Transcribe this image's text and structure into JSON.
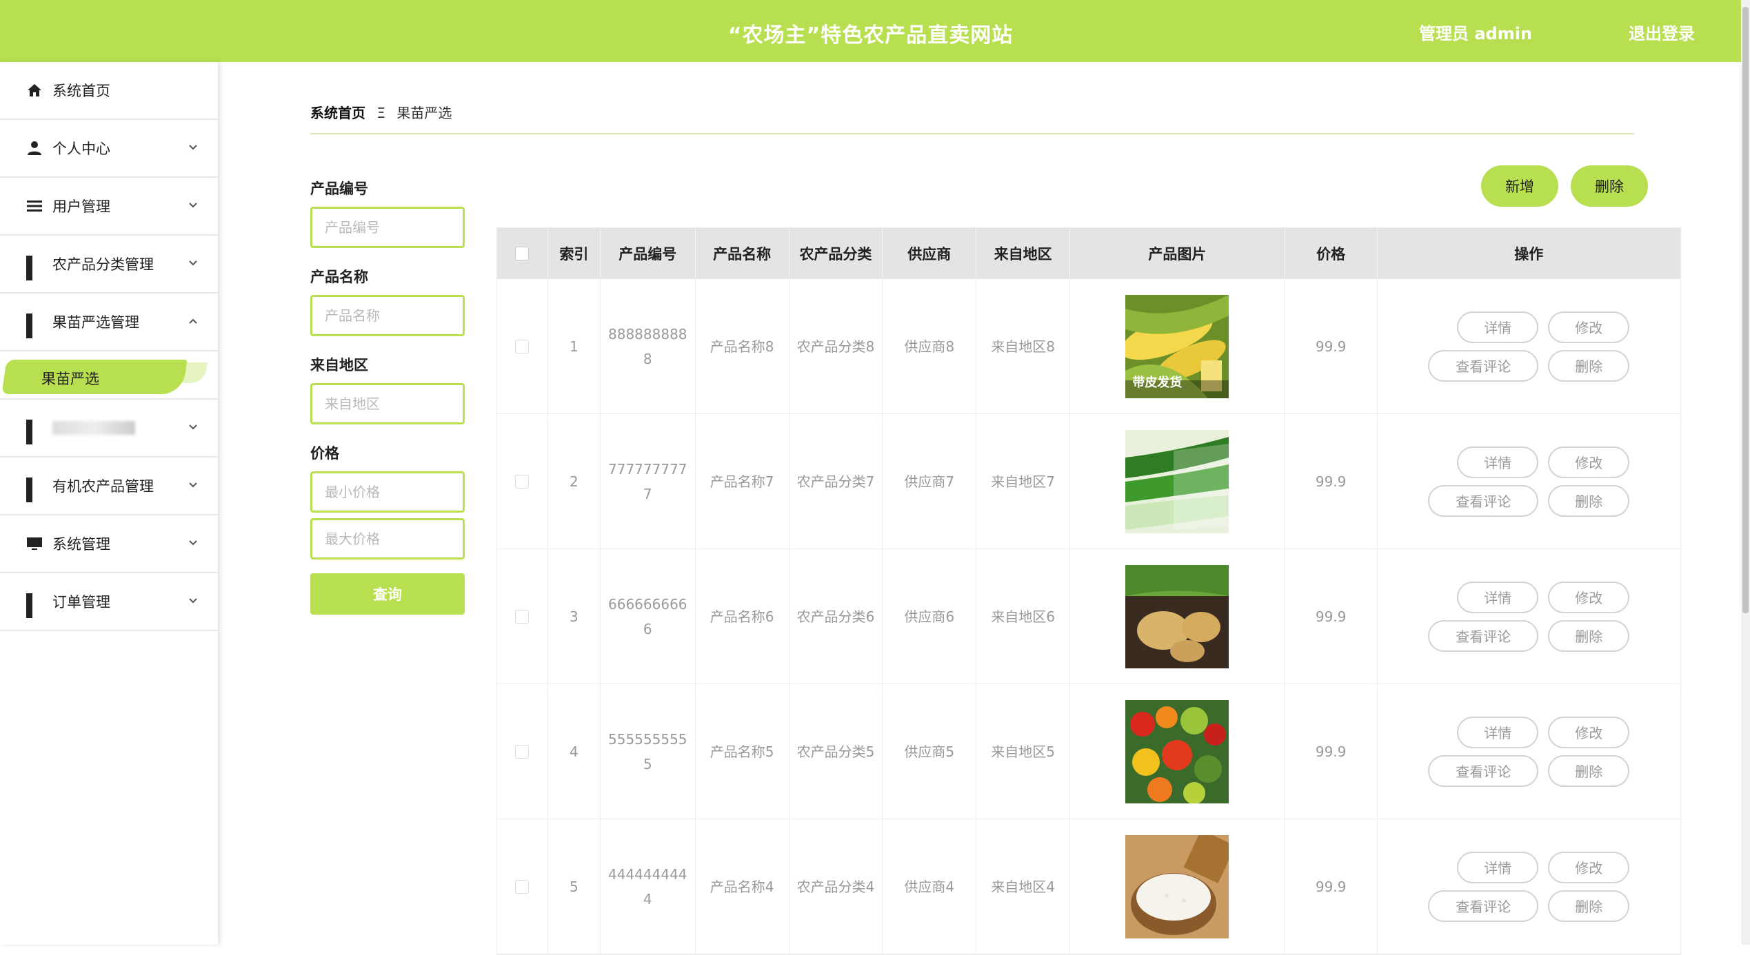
{
  "header": {
    "title": "“农场主”特色农产品直卖网站",
    "admin": "管理员 admin",
    "logout": "退出登录"
  },
  "sidebar": {
    "items": [
      {
        "label": "系统首页",
        "icon": "home-icon"
      },
      {
        "label": "个人中心",
        "icon": "user-icon"
      },
      {
        "label": "用户管理",
        "icon": "list-icon"
      },
      {
        "label": "农产品分类管理",
        "icon": "grid-icon"
      },
      {
        "label": "果苗严选管理",
        "icon": "grid-icon"
      },
      {
        "label": "有机农产品管理",
        "icon": "grid-icon"
      },
      {
        "label": "系统管理",
        "icon": "monitor-icon"
      },
      {
        "label": "订单管理",
        "icon": "grid-icon"
      }
    ],
    "active_sub": "果苗严选"
  },
  "breadcrumb": {
    "home": "系统首页",
    "sep": "Ξ",
    "current": "果苗严选"
  },
  "search": {
    "code_label": "产品编号",
    "code_placeholder": "产品编号",
    "name_label": "产品名称",
    "name_placeholder": "产品名称",
    "region_label": "来自地区",
    "region_placeholder": "来自地区",
    "price_label": "价格",
    "min_placeholder": "最小价格",
    "max_placeholder": "最大价格",
    "query": "查询"
  },
  "actions": {
    "add": "新增",
    "delete": "删除"
  },
  "table": {
    "headers": [
      "索引",
      "产品编号",
      "产品名称",
      "农产品分类",
      "供应商",
      "来自地区",
      "产品图片",
      "价格",
      "操作"
    ],
    "ops": {
      "detail": "详情",
      "edit": "修改",
      "comments": "查看评论",
      "delete": "删除"
    },
    "rows": [
      {
        "index": "1",
        "code": "8888888888",
        "name": "产品名称8",
        "category": "农产品分类8",
        "supplier": "供应商8",
        "region": "来自地区8",
        "image": "corn",
        "image_caption": "带皮发货",
        "price": "99.9"
      },
      {
        "index": "2",
        "code": "7777777777",
        "name": "产品名称7",
        "category": "农产品分类7",
        "supplier": "供应商7",
        "region": "来自地区7",
        "image": "leek",
        "price": "99.9"
      },
      {
        "index": "3",
        "code": "6666666666",
        "name": "产品名称6",
        "category": "农产品分类6",
        "supplier": "供应商6",
        "region": "来自地区6",
        "image": "potato",
        "price": "99.9"
      },
      {
        "index": "4",
        "code": "5555555555",
        "name": "产品名称5",
        "category": "农产品分类5",
        "supplier": "供应商5",
        "region": "来自地区5",
        "image": "vegetables",
        "price": "99.9"
      },
      {
        "index": "5",
        "code": "4444444444",
        "name": "产品名称4",
        "category": "农产品分类4",
        "supplier": "供应商4",
        "region": "来自地区4",
        "image": "rice",
        "price": "99.9"
      }
    ]
  },
  "colors": {
    "accent": "#b8df4f"
  }
}
